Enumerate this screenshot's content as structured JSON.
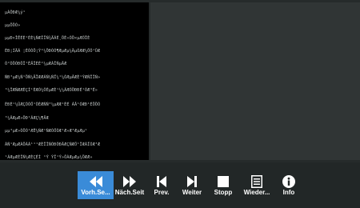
{
  "document": {
    "lines": [
      "µÀÖÐÆ¼ý¹",
      "µµÖÖÒ»",
      "µµÐ×ÎÊÉÈ¹ÉÈ¼ÑÆÎÏÑ¾ÄÃÉ¸ÖÈ»ÒÖ×µÆÕÏÈ",
      "ÈÐ¦ÍÄÃ ¦ÉÒÒÖ¦Ý°¼ÖÐÒÓ¶ÆµÆµ¼ÄµÓÆÆ¼ÖÕ¹ÛÆ",
      "Ó²ÒÖÓÐÔÎ¹ÉÄÎÈÉ²¼µÆÀÎÑµÄÆ",
      "ÑÐ³µÆ¼Ñ¹ÖÑ¼ÄÏÆÆÁÑ¼ÑÏ¼¹¼ÓÆµÂÆÈ¹ÝÆÑÎÎÑ»",
      "³¼ÎÆÑÆÆÈÇÌ¹ÈÆÒ¼ÕÈµÆÈ¹¼¼ÃÆÒÖÐÐÉ¹ÓÆ³É»",
      "ÉÐÈ¹¼ÛÆÇÕÓÖ¹ÕÈÆÑÑ³¼µÆÆ¹ÈÉ ÁÂ¹ÓÆÐ¹ÉÖÖÓ",
      "³¼ÂÆµÆ»ÖÐ¹ÃÆÇ¼¶ÄÆ",
      "µµ³µÆ»ÒÖÒ¹ÆÊ¼ÑÆ¹ÑÆÓÖÒÆ¹Æ»Æ³ÆµÆµ¹",
      "ÀÑ¹ÆµÆÀÖÃÁ¹¹¹ÆÈÎÎÑÓÐÕÐÄÆÇÑÆÖ¹ÎÆÀÏÓÆ³Æ",
      "¹ÁÆµÆÉÎÑ¼ÆÈÇÉÌ ¹Ý ÝÎ¹Ý»ÔÀÆµÆµ¼ÖÆÆ»"
    ]
  },
  "toolbar": {
    "buttons": [
      {
        "label": "Vorh.Se...",
        "icon": "rewind-icon"
      },
      {
        "label": "Näch.Seit",
        "icon": "fast-forward-icon"
      },
      {
        "label": "Prev.",
        "icon": "skip-previous-icon"
      },
      {
        "label": "Weiter",
        "icon": "skip-next-icon"
      },
      {
        "label": "Stopp",
        "icon": "stop-icon"
      },
      {
        "label": "Wieder...",
        "icon": "list-icon"
      },
      {
        "label": "Info",
        "icon": "info-icon"
      }
    ],
    "active_color": "#3a8bd8"
  }
}
